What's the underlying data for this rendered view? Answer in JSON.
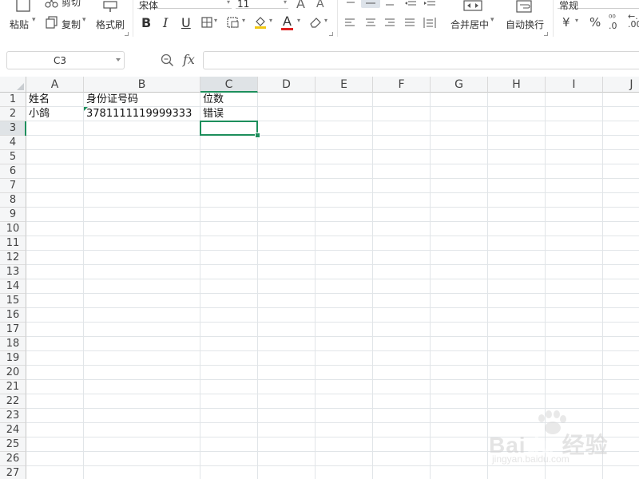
{
  "ribbon": {
    "clipboard": {
      "paste": "粘贴",
      "cut": "剪切",
      "copy": "复制",
      "format_painter": "格式刷"
    },
    "font": {
      "name": "宋体",
      "size": "11",
      "bold": "B",
      "italic": "I",
      "underline": "U",
      "font_color_glyph": "A"
    },
    "align": {
      "merge_center": "合并居中",
      "wrap_text": "自动换行"
    },
    "number": {
      "format": "常规",
      "currency": "¥",
      "percent": "%"
    }
  },
  "formula_bar": {
    "name_box": "C3",
    "fx": "fx",
    "formula": ""
  },
  "sheet": {
    "columns": [
      "A",
      "B",
      "C",
      "D",
      "E",
      "F",
      "G",
      "H",
      "I",
      "J"
    ],
    "selected_column": "C",
    "rows": [
      "1",
      "2",
      "3",
      "4",
      "5",
      "6",
      "7",
      "8",
      "9",
      "10",
      "11",
      "12",
      "13",
      "14",
      "15",
      "16",
      "17",
      "18",
      "19",
      "20",
      "21",
      "22",
      "23",
      "24",
      "25",
      "26",
      "27"
    ],
    "selected_row": "3",
    "cells": {
      "A1": "姓名",
      "B1": "身份证号码",
      "C1": "位数",
      "A2": "小鸽",
      "B2": "3781111119999333",
      "C2": "错误"
    },
    "active_cell": "C3"
  },
  "colors": {
    "accent": "#1d8f5c",
    "grid": "#e1e5e8",
    "header_bg": "#f5f6f7",
    "header_sel_bg": "#dfe3e6"
  }
}
